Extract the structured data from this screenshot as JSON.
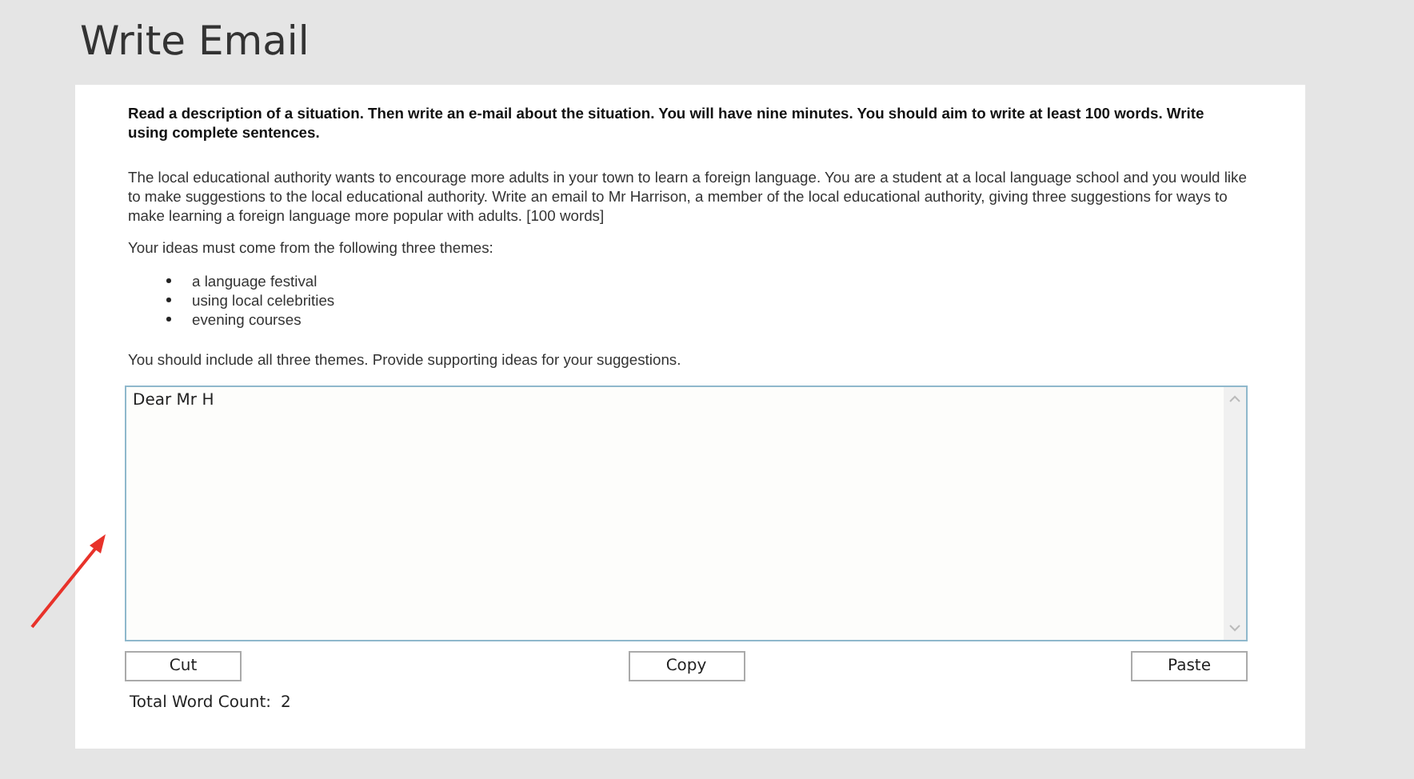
{
  "page_title": "Write Email",
  "instructions": "Read a description of a situation. Then write an e-mail about the situation. You will have nine minutes. You should aim to write at least 100 words. Write using complete sentences.",
  "situation": "The local educational authority wants to encourage more adults in your town to learn a foreign language. You are a student at a local language school and you would like to make suggestions to the local educational authority. Write an email to Mr Harrison, a member of the local educational authority, giving three suggestions for ways to make learning a foreign language more popular with adults. [100 words]",
  "themes_intro": "Your ideas must come from the following three themes:",
  "themes": [
    "a language festival",
    "using local celebrities",
    "evening courses"
  ],
  "closing": "You should include all three themes. Provide supporting ideas for your suggestions.",
  "answer": {
    "value": "Dear Mr H"
  },
  "buttons": [
    "Cut",
    "Copy",
    "Paste"
  ],
  "word_count": {
    "label": "Total Word Count:",
    "value": "2"
  }
}
